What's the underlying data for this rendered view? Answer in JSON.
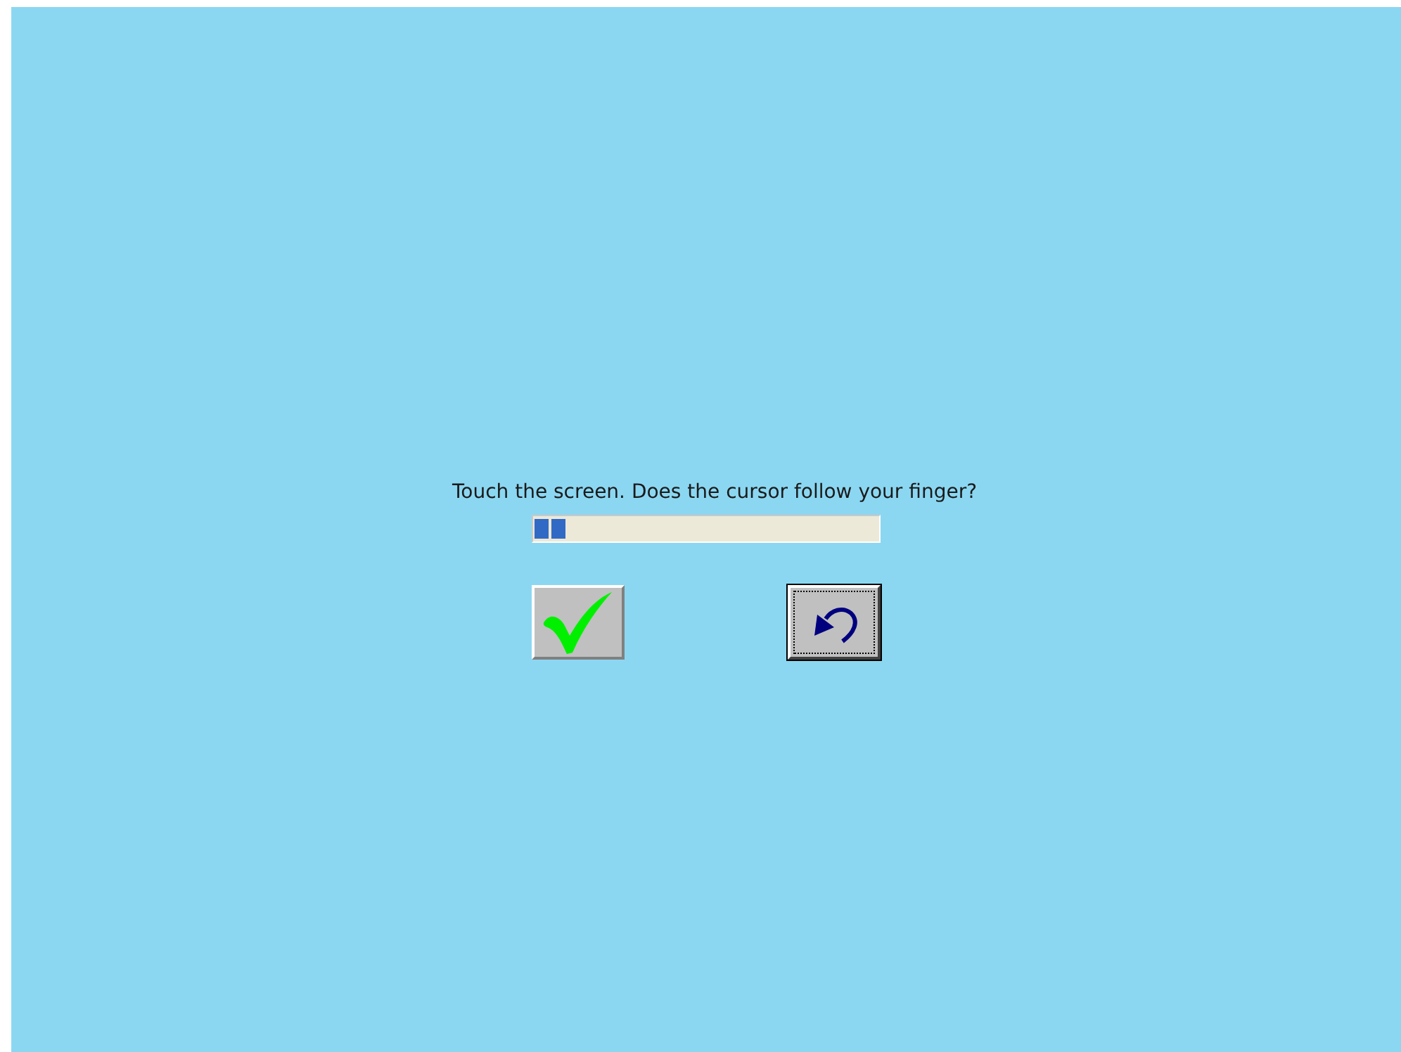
{
  "prompt": "Touch the screen. Does the cursor follow your finger?",
  "progress": {
    "level": 0.1
  },
  "buttons": [
    {
      "kind": "accept",
      "focused": false
    },
    {
      "kind": "undo",
      "focused": true
    }
  ]
}
